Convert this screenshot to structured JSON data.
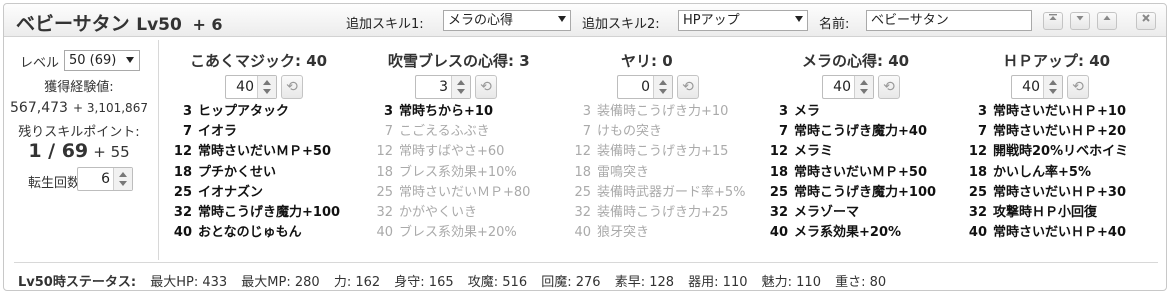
{
  "header": {
    "monster_name": "ベビーサタン",
    "level": "Lv50",
    "plus": "+ 6",
    "extra_skill1_label": "追加スキル1:",
    "extra_skill1_value": "メラの心得",
    "extra_skill2_label": "追加スキル2:",
    "extra_skill2_value": "HPアップ",
    "name_label": "名前:",
    "name_value": "ベビーサタン"
  },
  "left": {
    "level_label": "レベル",
    "level_value": "50 (69)",
    "exp_label": "獲得経験値:",
    "exp_value": "567,473",
    "exp_extra": "+ 3,101,867",
    "sp_label": "残りスキルポイント:",
    "sp_value": "1 / 69",
    "sp_extra": "+ 55",
    "rebirth_label": "転生回数",
    "rebirth_value": "6"
  },
  "skills": [
    {
      "name": "こあくマジック: 40",
      "points": "40",
      "rows": [
        {
          "lv": "3",
          "text": "ヒップアタック",
          "on": true
        },
        {
          "lv": "7",
          "text": "イオラ",
          "on": true
        },
        {
          "lv": "12",
          "text": "常時さいだいＭＰ+50",
          "on": true
        },
        {
          "lv": "18",
          "text": "プチかくせい",
          "on": true
        },
        {
          "lv": "25",
          "text": "イオナズン",
          "on": true
        },
        {
          "lv": "32",
          "text": "常時こうげき魔力+100",
          "on": true
        },
        {
          "lv": "40",
          "text": "おとなのじゅもん",
          "on": true
        }
      ]
    },
    {
      "name": "吹雪ブレスの心得: 3",
      "points": "3",
      "rows": [
        {
          "lv": "3",
          "text": "常時ちから+10",
          "on": true
        },
        {
          "lv": "7",
          "text": "こごえるふぶき",
          "on": false
        },
        {
          "lv": "12",
          "text": "常時すばやさ+60",
          "on": false
        },
        {
          "lv": "18",
          "text": "ブレス系効果+10%",
          "on": false
        },
        {
          "lv": "25",
          "text": "常時さいだいＭＰ+80",
          "on": false
        },
        {
          "lv": "32",
          "text": "かがやくいき",
          "on": false
        },
        {
          "lv": "40",
          "text": "ブレス系効果+20%",
          "on": false
        }
      ]
    },
    {
      "name": "ヤリ: 0",
      "points": "0",
      "rows": [
        {
          "lv": "3",
          "text": "装備時こうげき力+10",
          "on": false
        },
        {
          "lv": "7",
          "text": "けもの突き",
          "on": false
        },
        {
          "lv": "12",
          "text": "装備時こうげき力+15",
          "on": false
        },
        {
          "lv": "18",
          "text": "雷鳴突き",
          "on": false
        },
        {
          "lv": "25",
          "text": "装備時武器ガード率+5%",
          "on": false
        },
        {
          "lv": "32",
          "text": "装備時こうげき力+25",
          "on": false
        },
        {
          "lv": "40",
          "text": "狼牙突き",
          "on": false
        }
      ]
    },
    {
      "name": "メラの心得: 40",
      "points": "40",
      "rows": [
        {
          "lv": "3",
          "text": "メラ",
          "on": true
        },
        {
          "lv": "7",
          "text": "常時こうげき魔力+40",
          "on": true
        },
        {
          "lv": "12",
          "text": "メラミ",
          "on": true
        },
        {
          "lv": "18",
          "text": "常時さいだいＭＰ+50",
          "on": true
        },
        {
          "lv": "25",
          "text": "常時こうげき魔力+100",
          "on": true
        },
        {
          "lv": "32",
          "text": "メラゾーマ",
          "on": true
        },
        {
          "lv": "40",
          "text": "メラ系効果+20%",
          "on": true
        }
      ]
    },
    {
      "name": "ＨＰアップ: 40",
      "points": "40",
      "rows": [
        {
          "lv": "3",
          "text": "常時さいだいＨＰ+10",
          "on": true
        },
        {
          "lv": "7",
          "text": "常時さいだいＨＰ+20",
          "on": true
        },
        {
          "lv": "12",
          "text": "開戦時20%リベホイミ",
          "on": true
        },
        {
          "lv": "18",
          "text": "かいしん率+5%",
          "on": true
        },
        {
          "lv": "25",
          "text": "常時さいだいＨＰ+30",
          "on": true
        },
        {
          "lv": "32",
          "text": "攻撃時ＨＰ小回復",
          "on": true
        },
        {
          "lv": "40",
          "text": "常時さいだいＨＰ+40",
          "on": true
        }
      ]
    }
  ],
  "status": {
    "label": "Lv50時ステータス:",
    "stats": [
      "最大HP:  433",
      "最大MP:  280",
      "力:  162",
      "身守:  165",
      "攻魔:  516",
      "回魔:  276",
      "素早:  128",
      "器用:  110",
      "魅力:  110",
      "重さ:  80"
    ]
  }
}
